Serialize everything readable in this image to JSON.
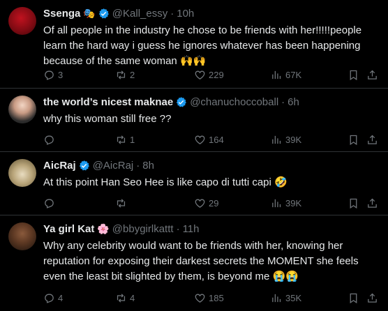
{
  "tweets": [
    {
      "name": "Ssenga",
      "name_emoji": "🎭",
      "handle": "@Kall_essy",
      "time": "10h",
      "text": "Of all people in the industry he chose to be friends with her!!!!!people learn the hard way i guess he ignores whatever has been happening because of the same woman 🙌🙌",
      "replies": "3",
      "retweets": "2",
      "likes": "229",
      "views": "67K"
    },
    {
      "name": "the world’s nicest maknae",
      "name_emoji": "",
      "handle": "@chanuchoccoball",
      "time": "6h",
      "text": "why this woman still free ??",
      "replies": "",
      "retweets": "1",
      "likes": "164",
      "views": "39K"
    },
    {
      "name": "AicRaj",
      "name_emoji": "",
      "handle": "@AicRaj",
      "time": "8h",
      "text": "At this point Han Seo Hee is like capo di tutti capi 🤣",
      "replies": "",
      "retweets": "",
      "likes": "29",
      "views": "39K"
    },
    {
      "name": "Ya girl Kat",
      "name_emoji": "🌸",
      "handle": "@bbygirlkattt",
      "time": "11h",
      "text": "Why any celebrity would want to be friends with her, knowing her reputation for exposing their darkest secrets the MOMENT she feels even the least bit slighted by them, is beyond me 😭😭",
      "replies": "4",
      "retweets": "4",
      "likes": "185",
      "views": "35K"
    }
  ],
  "separator": "·",
  "icons": [
    "reply-icon",
    "retweet-icon",
    "like-icon",
    "views-icon",
    "bookmark-icon",
    "share-icon",
    "verified-icon"
  ],
  "colors": {
    "background": "#000000",
    "text": "#e7e9ea",
    "muted": "#71767b",
    "verified": "#1d9bf0",
    "divider": "#2f3336"
  }
}
